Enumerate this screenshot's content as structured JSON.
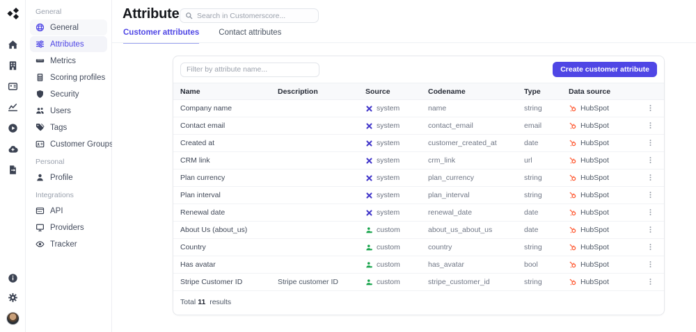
{
  "colors": {
    "accent": "#4f46e5",
    "system_icon": "#4338ca",
    "custom_icon": "#16a34a",
    "hubspot": "#ff5c35"
  },
  "rail": {
    "nav_icons": [
      "home",
      "building",
      "id-badge",
      "chart",
      "play",
      "cloud-upload",
      "file-export"
    ],
    "bottom_icons": [
      "info",
      "gear"
    ]
  },
  "sidebar": {
    "sections": [
      {
        "label": "General",
        "items": [
          {
            "label": "General",
            "icon": "globe",
            "state": "hl"
          },
          {
            "label": "Attributes",
            "icon": "sliders",
            "state": "active"
          },
          {
            "label": "Metrics",
            "icon": "ruler",
            "state": ""
          },
          {
            "label": "Scoring profiles",
            "icon": "calculator",
            "state": ""
          },
          {
            "label": "Security",
            "icon": "shield",
            "state": ""
          },
          {
            "label": "Users",
            "icon": "users",
            "state": ""
          },
          {
            "label": "Tags",
            "icon": "tags",
            "state": ""
          },
          {
            "label": "Customer Groups",
            "icon": "id-card",
            "state": ""
          }
        ]
      },
      {
        "label": "Personal",
        "items": [
          {
            "label": "Profile",
            "icon": "user",
            "state": ""
          }
        ]
      },
      {
        "label": "Integrations",
        "items": [
          {
            "label": "API",
            "icon": "api",
            "state": ""
          },
          {
            "label": "Providers",
            "icon": "monitor",
            "state": ""
          },
          {
            "label": "Tracker",
            "icon": "eye",
            "state": ""
          }
        ]
      }
    ]
  },
  "header": {
    "title": "Attributes",
    "search_placeholder": "Search in Customerscore...",
    "tabs": [
      {
        "label": "Customer attributes",
        "active": true
      },
      {
        "label": "Contact attributes",
        "active": false
      }
    ]
  },
  "toolbar": {
    "filter_placeholder": "Filter by attribute name...",
    "create_button_label": "Create customer attribute"
  },
  "table": {
    "columns": [
      "Name",
      "Description",
      "Source",
      "Codename",
      "Type",
      "Data source"
    ],
    "rows": [
      {
        "name": "Company name",
        "description": "",
        "source": "system",
        "codename": "name",
        "type": "string",
        "data_source": "HubSpot"
      },
      {
        "name": "Contact email",
        "description": "",
        "source": "system",
        "codename": "contact_email",
        "type": "email",
        "data_source": "HubSpot"
      },
      {
        "name": "Created at",
        "description": "",
        "source": "system",
        "codename": "customer_created_at",
        "type": "date",
        "data_source": "HubSpot"
      },
      {
        "name": "CRM link",
        "description": "",
        "source": "system",
        "codename": "crm_link",
        "type": "url",
        "data_source": "HubSpot"
      },
      {
        "name": "Plan currency",
        "description": "",
        "source": "system",
        "codename": "plan_currency",
        "type": "string",
        "data_source": "HubSpot"
      },
      {
        "name": "Plan interval",
        "description": "",
        "source": "system",
        "codename": "plan_interval",
        "type": "string",
        "data_source": "HubSpot"
      },
      {
        "name": "Renewal date",
        "description": "",
        "source": "system",
        "codename": "renewal_date",
        "type": "date",
        "data_source": "HubSpot"
      },
      {
        "name": "About Us (about_us)",
        "description": "",
        "source": "custom",
        "codename": "about_us_about_us",
        "type": "date",
        "data_source": "HubSpot"
      },
      {
        "name": "Country",
        "description": "",
        "source": "custom",
        "codename": "country",
        "type": "string",
        "data_source": "HubSpot"
      },
      {
        "name": "Has avatar",
        "description": "",
        "source": "custom",
        "codename": "has_avatar",
        "type": "bool",
        "data_source": "HubSpot"
      },
      {
        "name": "Stripe Customer ID",
        "description": "Stripe customer ID",
        "source": "custom",
        "codename": "stripe_customer_id",
        "type": "string",
        "data_source": "HubSpot"
      }
    ]
  },
  "footer": {
    "total_label": "Total",
    "total_count": "11",
    "results_label": "results"
  }
}
